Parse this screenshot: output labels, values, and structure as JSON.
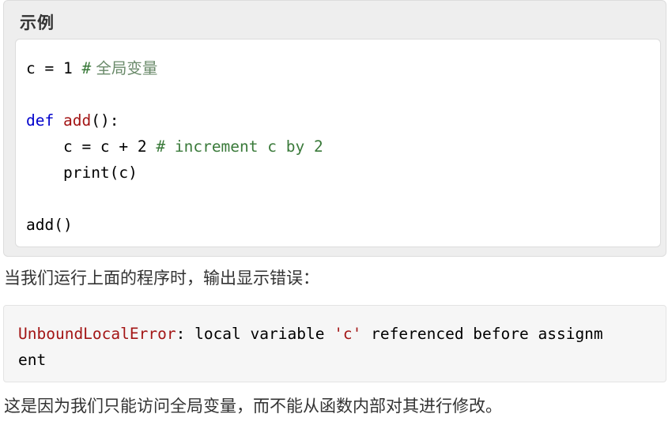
{
  "example": {
    "title": "示例",
    "code_lines": [
      {
        "var": "c",
        "op": " = ",
        "num": "1",
        "sp": " ",
        "hash": "#",
        "comment": " 全局变量"
      },
      {},
      {
        "kw": "def",
        "sp": " ",
        "fn": "add",
        "rest": "():"
      },
      {
        "indent": "    ",
        "text": "c = c + 2 ",
        "comment": "# increment c by 2"
      },
      {
        "indent": "    ",
        "text": "print(c)"
      },
      {},
      {
        "text": "add()"
      }
    ]
  },
  "para1": "当我们运行上面的程序时，输出显示错误：",
  "output": {
    "error_name": "UnboundLocalError",
    "colon": ":",
    "text_a": " local variable ",
    "quoted": "'c'",
    "text_b": " referenced before assignm",
    "text_c": "ent"
  },
  "para2": "这是因为我们只能访问全局变量，而不能从函数内部对其进行修改。",
  "colors": {
    "keyword": "#0000cc",
    "function_name": "#a31515",
    "comment": "#3a7a3a",
    "error_name": "#a31515",
    "string": "#a31515",
    "example_bg": "#eeeeee",
    "output_bg": "#f6f6f6"
  }
}
